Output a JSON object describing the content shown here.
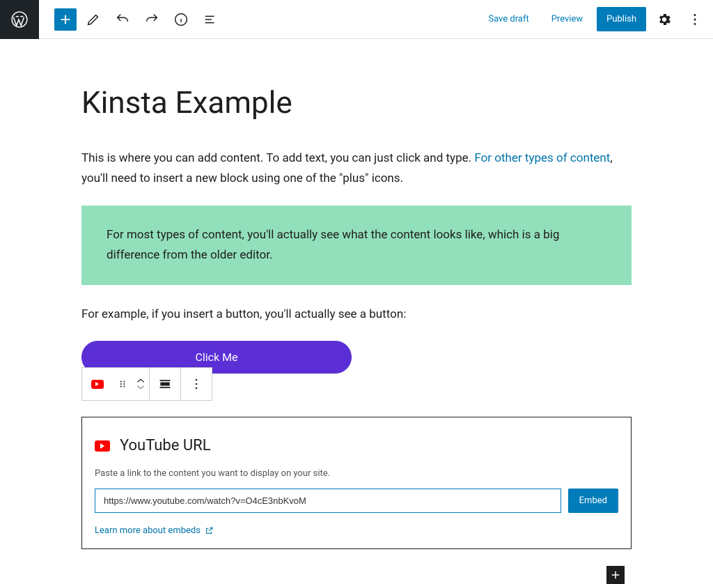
{
  "toolbar": {
    "save_draft": "Save draft",
    "preview": "Preview",
    "publish": "Publish"
  },
  "post": {
    "title": "Kinsta Example",
    "para1_a": "This is where you can add content. To add text, you can just click and type. ",
    "para1_link": "For other types of content",
    "para1_b": ", you'll need to insert a new block using one of the \"plus\" icons.",
    "callout": "For most types of content, you'll actually see what the content looks like, which is a big difference from the older editor.",
    "para2": "For example, if you insert a button, you'll actually see a button:",
    "button_label": "Click Me"
  },
  "embed": {
    "title": "YouTube URL",
    "description": "Paste a link to the content you want to display on your site.",
    "url": "https://www.youtube.com/watch?v=O4cE3nbKvoM",
    "button": "Embed",
    "learn_more": "Learn more about embeds"
  }
}
